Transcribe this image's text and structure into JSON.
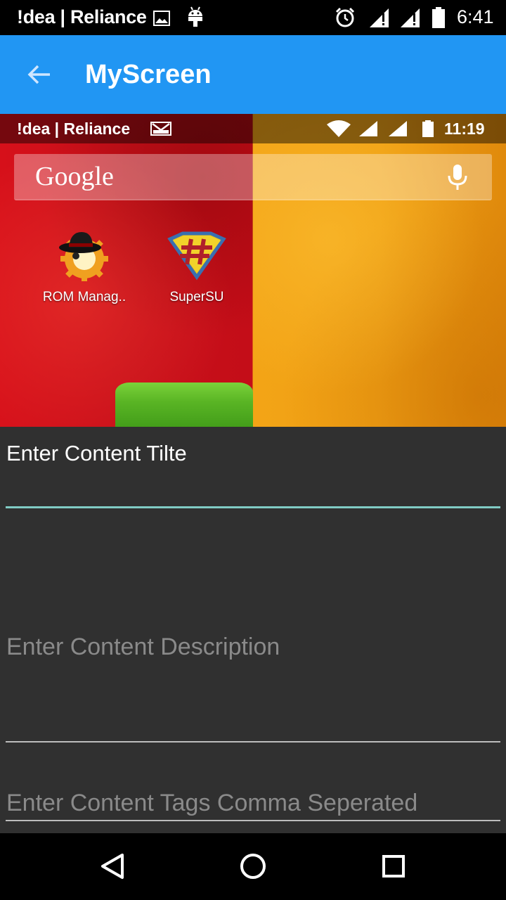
{
  "status_bar": {
    "carrier": "!dea | Reliance",
    "time": "6:41",
    "icons": [
      "gallery-icon",
      "android-debug-icon",
      "alarm-icon",
      "signal-icon",
      "signal-icon",
      "battery-icon"
    ]
  },
  "app_bar": {
    "title": "MyScreen",
    "back_icon": "arrow-back-icon",
    "color": "#2196F3"
  },
  "image_preview": {
    "inner_status": {
      "carrier": "!dea | Reliance",
      "time": "11:19"
    },
    "search_bar_label": "Google",
    "apps": [
      {
        "label": "ROM Manag..",
        "icon": "rom-manager-icon"
      },
      {
        "label": "SuperSU",
        "icon": "supersu-icon"
      }
    ]
  },
  "form": {
    "title_field": {
      "value": "Enter Content Tilte",
      "underline_color": "#80cbc4"
    },
    "description_field": {
      "placeholder": "Enter Content Description"
    },
    "tags_field": {
      "placeholder": "Enter Content Tags Comma Seperated"
    }
  },
  "nav_bar": {
    "buttons": [
      "nav-back-icon",
      "nav-home-icon",
      "nav-recents-icon"
    ]
  }
}
